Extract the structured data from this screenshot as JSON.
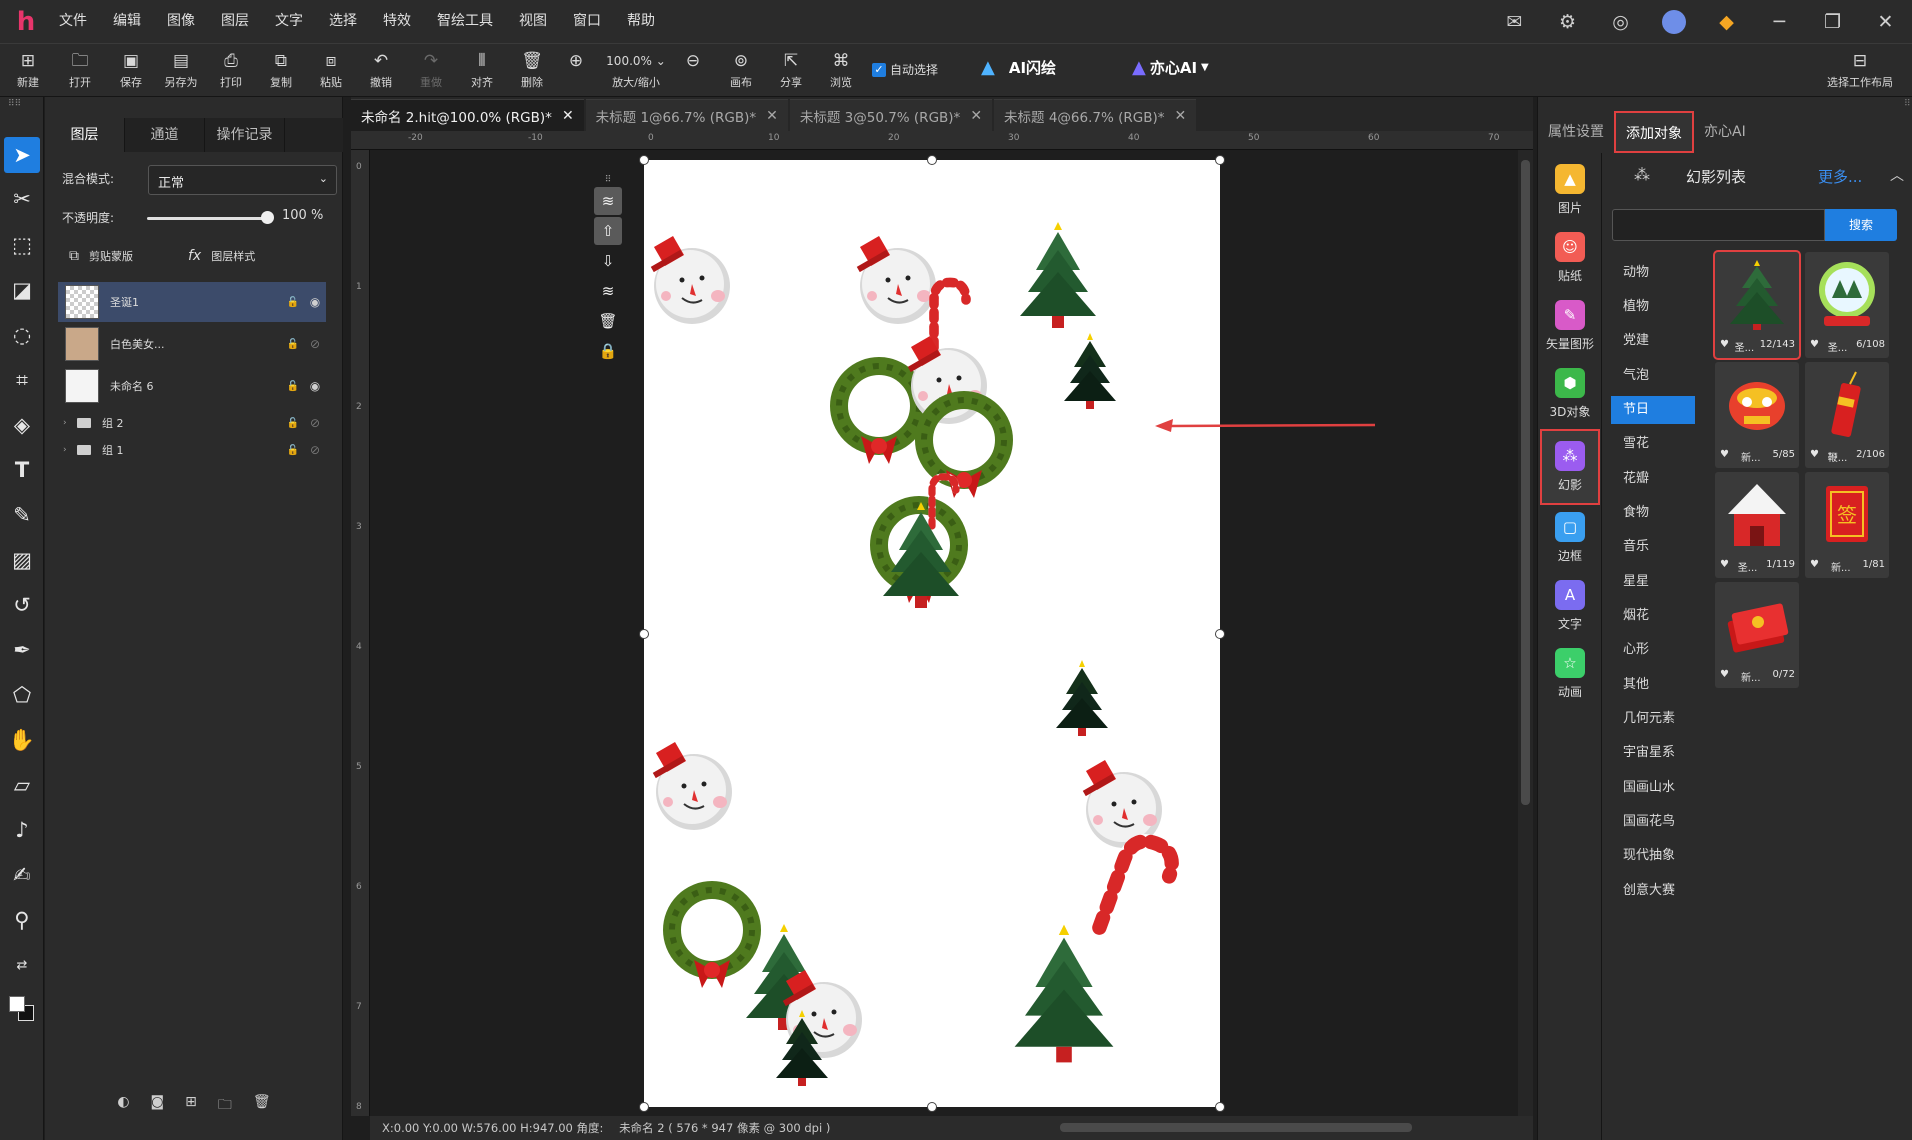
{
  "menu": [
    "文件",
    "编辑",
    "图像",
    "图层",
    "文字",
    "选择",
    "特效",
    "智绘工具",
    "视图",
    "窗口",
    "帮助"
  ],
  "toolbar": {
    "items": [
      "新建",
      "打开",
      "保存",
      "另存为",
      "打印",
      "复制",
      "粘贴",
      "撤销",
      "重做",
      "对齐",
      "删除"
    ],
    "zoom_value": "100.0%",
    "zoom_label": "放大/缩小",
    "items2": [
      "画布",
      "分享",
      "浏览"
    ],
    "auto_select": "自动选择",
    "ai_flash": "AI闪绘",
    "yixin_ai": "亦心AI",
    "workspace": "选择工作布局"
  },
  "layers_panel": {
    "tabs": [
      "图层",
      "通道",
      "操作记录"
    ],
    "blend_label": "混合模式:",
    "blend_value": "正常",
    "opacity_label": "不透明度:",
    "opacity_value": "100",
    "opacity_unit": "%",
    "opacity_level": 1.0,
    "clip_mask": "剪贴蒙版",
    "layer_style": "图层样式",
    "layers": [
      "圣诞1",
      "白色美女...",
      "未命名 6"
    ],
    "groups": [
      "组 2",
      "组 1"
    ]
  },
  "doc_tabs": [
    "未命名 2.hit@100.0% (RGB)*",
    "未标题 1@66.7% (RGB)*",
    "未标题 3@50.7% (RGB)*",
    "未标题 4@66.7% (RGB)*"
  ],
  "ruler": [
    "-20",
    "-10",
    "0",
    "10",
    "20",
    "30",
    "40",
    "50",
    "60",
    "70"
  ],
  "ruler_v": [
    "0",
    "1",
    "2",
    "3",
    "4",
    "5",
    "6",
    "7",
    "8"
  ],
  "status": {
    "coords": "X:0.00 Y:0.00 W:576.00 H:947.00 角度:",
    "info": "未命名 2 ( 576 * 947 像素 @ 300 dpi )"
  },
  "right_panel": {
    "tabs": [
      "属性设置",
      "添加对象",
      "亦心AI"
    ],
    "categories": [
      "图片",
      "贴纸",
      "矢量图形",
      "3D对象",
      "幻影",
      "边框",
      "文字",
      "动画"
    ],
    "header_title": "幻影列表",
    "more": "更多...",
    "search_btn": "搜索",
    "subcats": [
      "动物",
      "植物",
      "党建",
      "气泡",
      "节日",
      "雪花",
      "花瓣",
      "食物",
      "音乐",
      "星星",
      "烟花",
      "心形",
      "其他",
      "几何元素",
      "宇宙星系",
      "国画山水",
      "国画花鸟",
      "现代抽象",
      "创意大赛"
    ],
    "cards": [
      {
        "name": "圣...",
        "count": "12/143"
      },
      {
        "name": "圣...",
        "count": "6/108"
      },
      {
        "name": "新...",
        "count": "5/85"
      },
      {
        "name": "鞭...",
        "count": "2/106"
      },
      {
        "name": "圣...",
        "count": "1/119"
      },
      {
        "name": "新...",
        "count": "1/81"
      },
      {
        "name": "新...",
        "count": "0/72"
      }
    ],
    "card_sign": "签"
  },
  "colors": {
    "accent": "#1f7ee0",
    "highlight": "#e04040",
    "logo": "#e8356b"
  }
}
